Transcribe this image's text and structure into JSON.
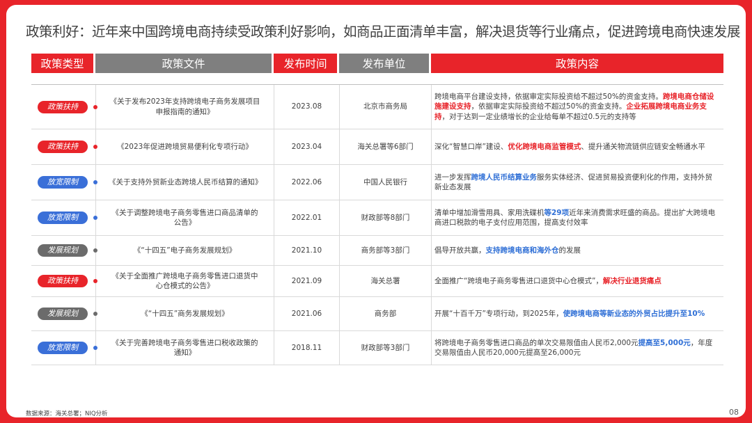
{
  "title": "政策利好：近年来中国跨境电商持续受政策利好影响，如商品正面清单丰富，解决退货等行业痛点，促进跨境电商快速发展",
  "colors": {
    "frame": "#e8242a",
    "support": "#e8242a",
    "relax": "#3a6fd8",
    "plan": "#6b6b6b",
    "header_gray": "#7f7f7f"
  },
  "table": {
    "headers": [
      "政策类型",
      "政策文件",
      "发布时间",
      "发布单位",
      "政策内容"
    ],
    "rows": [
      {
        "type": "政策扶持",
        "doc": "《关于发布2023年支持跨境电子商务发展项目申报指南的通知》",
        "date": "2023.08",
        "unit": "北京市商务局",
        "content": [
          {
            "t": "跨境电商平台建设支持，依据审定实际投资给不超过50%的资金支持。",
            "s": ""
          },
          {
            "t": "跨境电商仓储设施建设支持",
            "s": "red"
          },
          {
            "t": "，依据审定实际投资给不超过50%的资金支持。",
            "s": ""
          },
          {
            "t": "企业拓展跨境电商业务支持",
            "s": "red"
          },
          {
            "t": "，对于达到一定业绩增长的企业给每单不超过0.5元的支持等",
            "s": ""
          }
        ]
      },
      {
        "type": "政策扶持",
        "doc": "《2023年促进跨境贸易便利化专项行动》",
        "date": "2023.04",
        "unit": "海关总署等6部门",
        "content": [
          {
            "t": "深化“智慧口岸”建设、",
            "s": ""
          },
          {
            "t": "优化跨境电商监管模式",
            "s": "red"
          },
          {
            "t": "、提升通关物流链供应链安全畅通水平",
            "s": ""
          }
        ]
      },
      {
        "type": "放宽限制",
        "doc": "《关于支持外贸新业态跨境人民币结算的通知》",
        "date": "2022.06",
        "unit": "中国人民银行",
        "content": [
          {
            "t": "进一步发挥",
            "s": ""
          },
          {
            "t": "跨境人民币结算业务",
            "s": "blue"
          },
          {
            "t": "服务实体经济、促进贸易投资便利化的作用，支持外贸新业态发展",
            "s": ""
          }
        ]
      },
      {
        "type": "放宽限制",
        "doc": "《关于调整跨境电子商务零售进口商品清单的公告》",
        "date": "2022.01",
        "unit": "财政部等8部门",
        "content": [
          {
            "t": "清单中增加滑雪用具、家用洗碟机",
            "s": ""
          },
          {
            "t": "等29项",
            "s": "blue"
          },
          {
            "t": "近年来消费需求旺盛的商品。提出扩大跨境电商进口税款的电子支付应用范围，提高支付效率",
            "s": ""
          }
        ]
      },
      {
        "type": "发展规划",
        "doc": "《“十四五”电子商务发展规划》",
        "date": "2021.10",
        "unit": "商务部等3部门",
        "content": [
          {
            "t": "倡导开放共赢，",
            "s": ""
          },
          {
            "t": "支持跨境电商和海外仓",
            "s": "blue"
          },
          {
            "t": "的发展",
            "s": ""
          }
        ]
      },
      {
        "type": "政策扶持",
        "doc": "《关于全面推广跨境电子商务零售进口退货中心仓模式的公告》",
        "date": "2021.09",
        "unit": "海关总署",
        "content": [
          {
            "t": "全面推广“跨境电子商务零售进口退货中心仓模式”，",
            "s": ""
          },
          {
            "t": "解决行业退货痛点",
            "s": "red"
          }
        ]
      },
      {
        "type": "发展规划",
        "doc": "《“十四五”商务发展规划》",
        "date": "2021.06",
        "unit": "商务部",
        "content": [
          {
            "t": "开展“十百千万”专项行动，到2025年，",
            "s": ""
          },
          {
            "t": "使跨境电商等新业态的外贸占比提升至10%",
            "s": "blue"
          }
        ]
      },
      {
        "type": "放宽限制",
        "doc": "《关于完善跨境电子商务零售进口税收政策的通知》",
        "date": "2018.11",
        "unit": "财政部等3部门",
        "content": [
          {
            "t": "将跨境电子商务零售进口商品的单次交易限值由人民币2,000元",
            "s": ""
          },
          {
            "t": "提高至5,000元",
            "s": "blue"
          },
          {
            "t": "，年度交易限值由人民币20,000元提高至26,000元",
            "s": ""
          }
        ]
      }
    ]
  },
  "footer": {
    "source": "数据来源：海关总署；NIQ分析",
    "page": "08"
  }
}
